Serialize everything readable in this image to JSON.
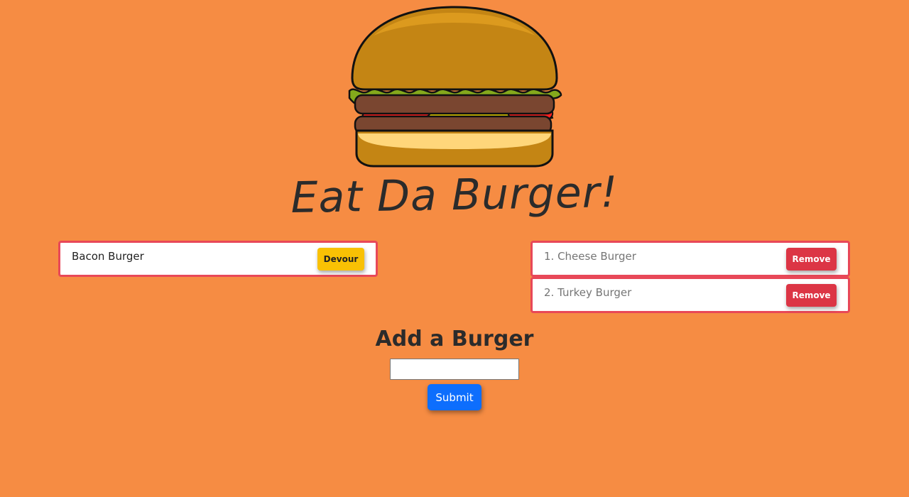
{
  "logo": {
    "icon": "burger-icon"
  },
  "title": "Eat Da Burger!",
  "uneaten": {
    "items": [
      {
        "name": "Bacon Burger",
        "button": "Devour"
      }
    ]
  },
  "devoured": {
    "items": [
      {
        "name": "1. Cheese Burger",
        "button": "Remove"
      },
      {
        "name": "2. Turkey Burger",
        "button": "Remove"
      }
    ]
  },
  "form": {
    "heading": "Add a Burger",
    "input_value": "",
    "input_placeholder": "",
    "submit_label": "Submit"
  },
  "colors": {
    "background": "#f68c43",
    "border": "#e84858",
    "devour": "#f9c104",
    "remove": "#dc3545",
    "submit": "#0d6efd"
  }
}
